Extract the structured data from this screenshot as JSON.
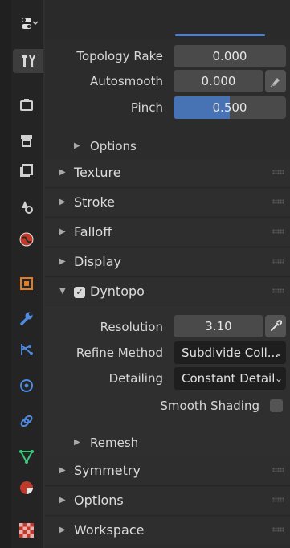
{
  "sidebar": {
    "menu_icon": "editor-type-icon",
    "tabs": [
      {
        "name": "tool-tab",
        "glyph": "🔧",
        "active": true
      },
      {
        "name": "render-tab"
      },
      {
        "name": "output-tab"
      },
      {
        "name": "view-layer-tab"
      },
      {
        "name": "scene-tab"
      },
      {
        "name": "world-tab"
      },
      {
        "name": "object-tab"
      },
      {
        "name": "modifier-tab"
      },
      {
        "name": "particles-tab"
      },
      {
        "name": "physics-tab"
      },
      {
        "name": "constraints-tab"
      },
      {
        "name": "data-tab"
      },
      {
        "name": "material-tab"
      },
      {
        "name": "texture-tab"
      }
    ]
  },
  "brush": {
    "topology_rake": {
      "label": "Topology Rake",
      "value": "0.000"
    },
    "autosmooth": {
      "label": "Autosmooth",
      "value": "0.000"
    },
    "pinch": {
      "label": "Pinch",
      "value": "0.500",
      "fill": 0.5
    },
    "options_label": "Options"
  },
  "panels": {
    "texture": "Texture",
    "stroke": "Stroke",
    "falloff": "Falloff",
    "display": "Display",
    "dyntopo": "Dyntopo",
    "symmetry": "Symmetry",
    "options": "Options",
    "workspace": "Workspace"
  },
  "dyntopo": {
    "enabled": true,
    "resolution": {
      "label": "Resolution",
      "value": "3.10"
    },
    "refine_method": {
      "label": "Refine Method",
      "value": "Subdivide Coll..."
    },
    "detailing": {
      "label": "Detailing",
      "value": "Constant Detail"
    },
    "smooth_shading": {
      "label": "Smooth Shading",
      "checked": false
    },
    "remesh_label": "Remesh"
  },
  "colors": {
    "accent": "#4772b3",
    "panel_bg": "#2c2c2c"
  }
}
